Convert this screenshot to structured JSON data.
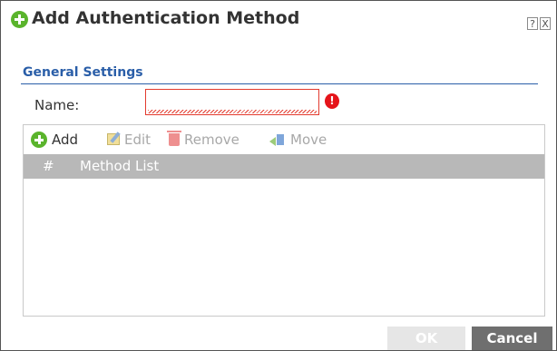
{
  "dialog": {
    "title": "Add Authentication Method",
    "help_label": "?",
    "close_label": "X",
    "icons": {
      "title": "add-circle-icon",
      "help": "question-icon",
      "close": "close-icon"
    }
  },
  "general_settings": {
    "section_title": "General Settings",
    "name_label": "Name:",
    "name_value": "",
    "name_placeholder": "",
    "error_icon": "!"
  },
  "toolbar": {
    "add": {
      "label": "Add",
      "icon": "add-icon"
    },
    "edit": {
      "label": "Edit",
      "icon": "edit-icon"
    },
    "remove": {
      "label": "Remove",
      "icon": "trash-icon"
    },
    "move": {
      "label": "Move",
      "icon": "move-icon"
    }
  },
  "table": {
    "columns": [
      "#",
      "Method List"
    ],
    "rows": []
  },
  "footer": {
    "ok_label": "OK",
    "cancel_label": "Cancel"
  },
  "colors": {
    "accent": "#5ab42c",
    "section": "#2a5ea8",
    "error": "#e5141a",
    "header": "#b8b8b8",
    "cancel": "#6f6f6f"
  }
}
